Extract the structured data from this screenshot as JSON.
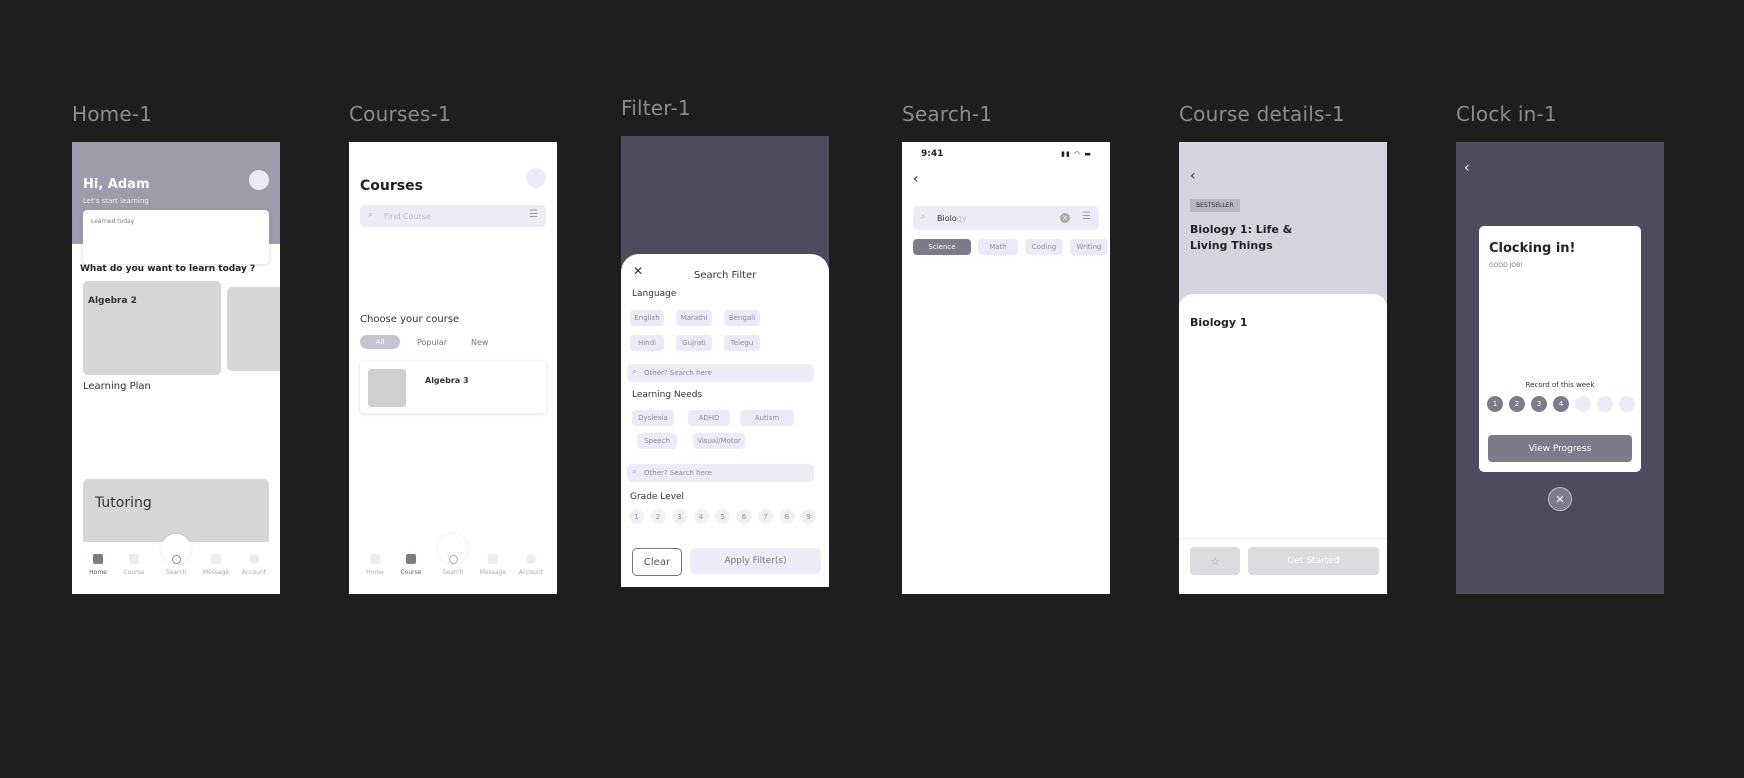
{
  "frames": {
    "home": "Home-1",
    "courses": "Courses-1",
    "filter": "Filter-1",
    "search": "Search-1",
    "details": "Course details-1",
    "clock": "Clock in-1"
  },
  "home": {
    "greeting": "Hi, Adam",
    "subtitle": "Let's start learning",
    "learned_today": "Learned today",
    "question": "What do you want to learn today ?",
    "card1": "Algebra 2",
    "learning_plan": "Learning Plan",
    "tutoring": "Tutoring"
  },
  "nav": {
    "home": "Home",
    "course": "Course",
    "search": "Search",
    "message": "Message",
    "account": "Account"
  },
  "courses": {
    "title": "Courses",
    "search_placeholder": "Find Course",
    "choose": "Choose your course",
    "tabs": [
      "All",
      "Popular",
      "New"
    ],
    "item": "Algebra 3"
  },
  "filter": {
    "title": "Search Filter",
    "language": "Language",
    "languages": [
      "English",
      "Marathi",
      "Bengali",
      "Hindi",
      "Gujrati",
      "Telegu"
    ],
    "other_placeholder": "Other? Search here",
    "needs": "Learning Needs",
    "needs_list": [
      "Dyslexia",
      "ADHD",
      "Autism",
      "Speech",
      "Visual/Motor"
    ],
    "grade": "Grade Level",
    "grades": [
      "1",
      "2",
      "3",
      "4",
      "5",
      "6",
      "7",
      "8",
      "9"
    ],
    "clear": "Clear",
    "apply": "Apply Filter(s)"
  },
  "search": {
    "time": "9:41",
    "query": "Biolo",
    "query_hint": "gy",
    "chips": [
      "Science",
      "Math",
      "Coding",
      "Writing"
    ]
  },
  "details": {
    "badge": "BESTSELLER",
    "title": "Biology 1: Life & Living Things",
    "section": "Biology 1",
    "get_started": "Get Started"
  },
  "clock": {
    "title": "Clocking in!",
    "subtitle": "GOOD JOB!",
    "record": "Record of this week",
    "days": [
      "1",
      "2",
      "3",
      "4",
      "",
      "",
      ""
    ],
    "completed_days": 4,
    "view": "View Progress"
  },
  "colors": {
    "bg": "#1e1e1e",
    "header": "#9d9caa",
    "dark": "#4c4c5e",
    "chip": "#eceaf8",
    "accent": "#7c7b8a"
  }
}
